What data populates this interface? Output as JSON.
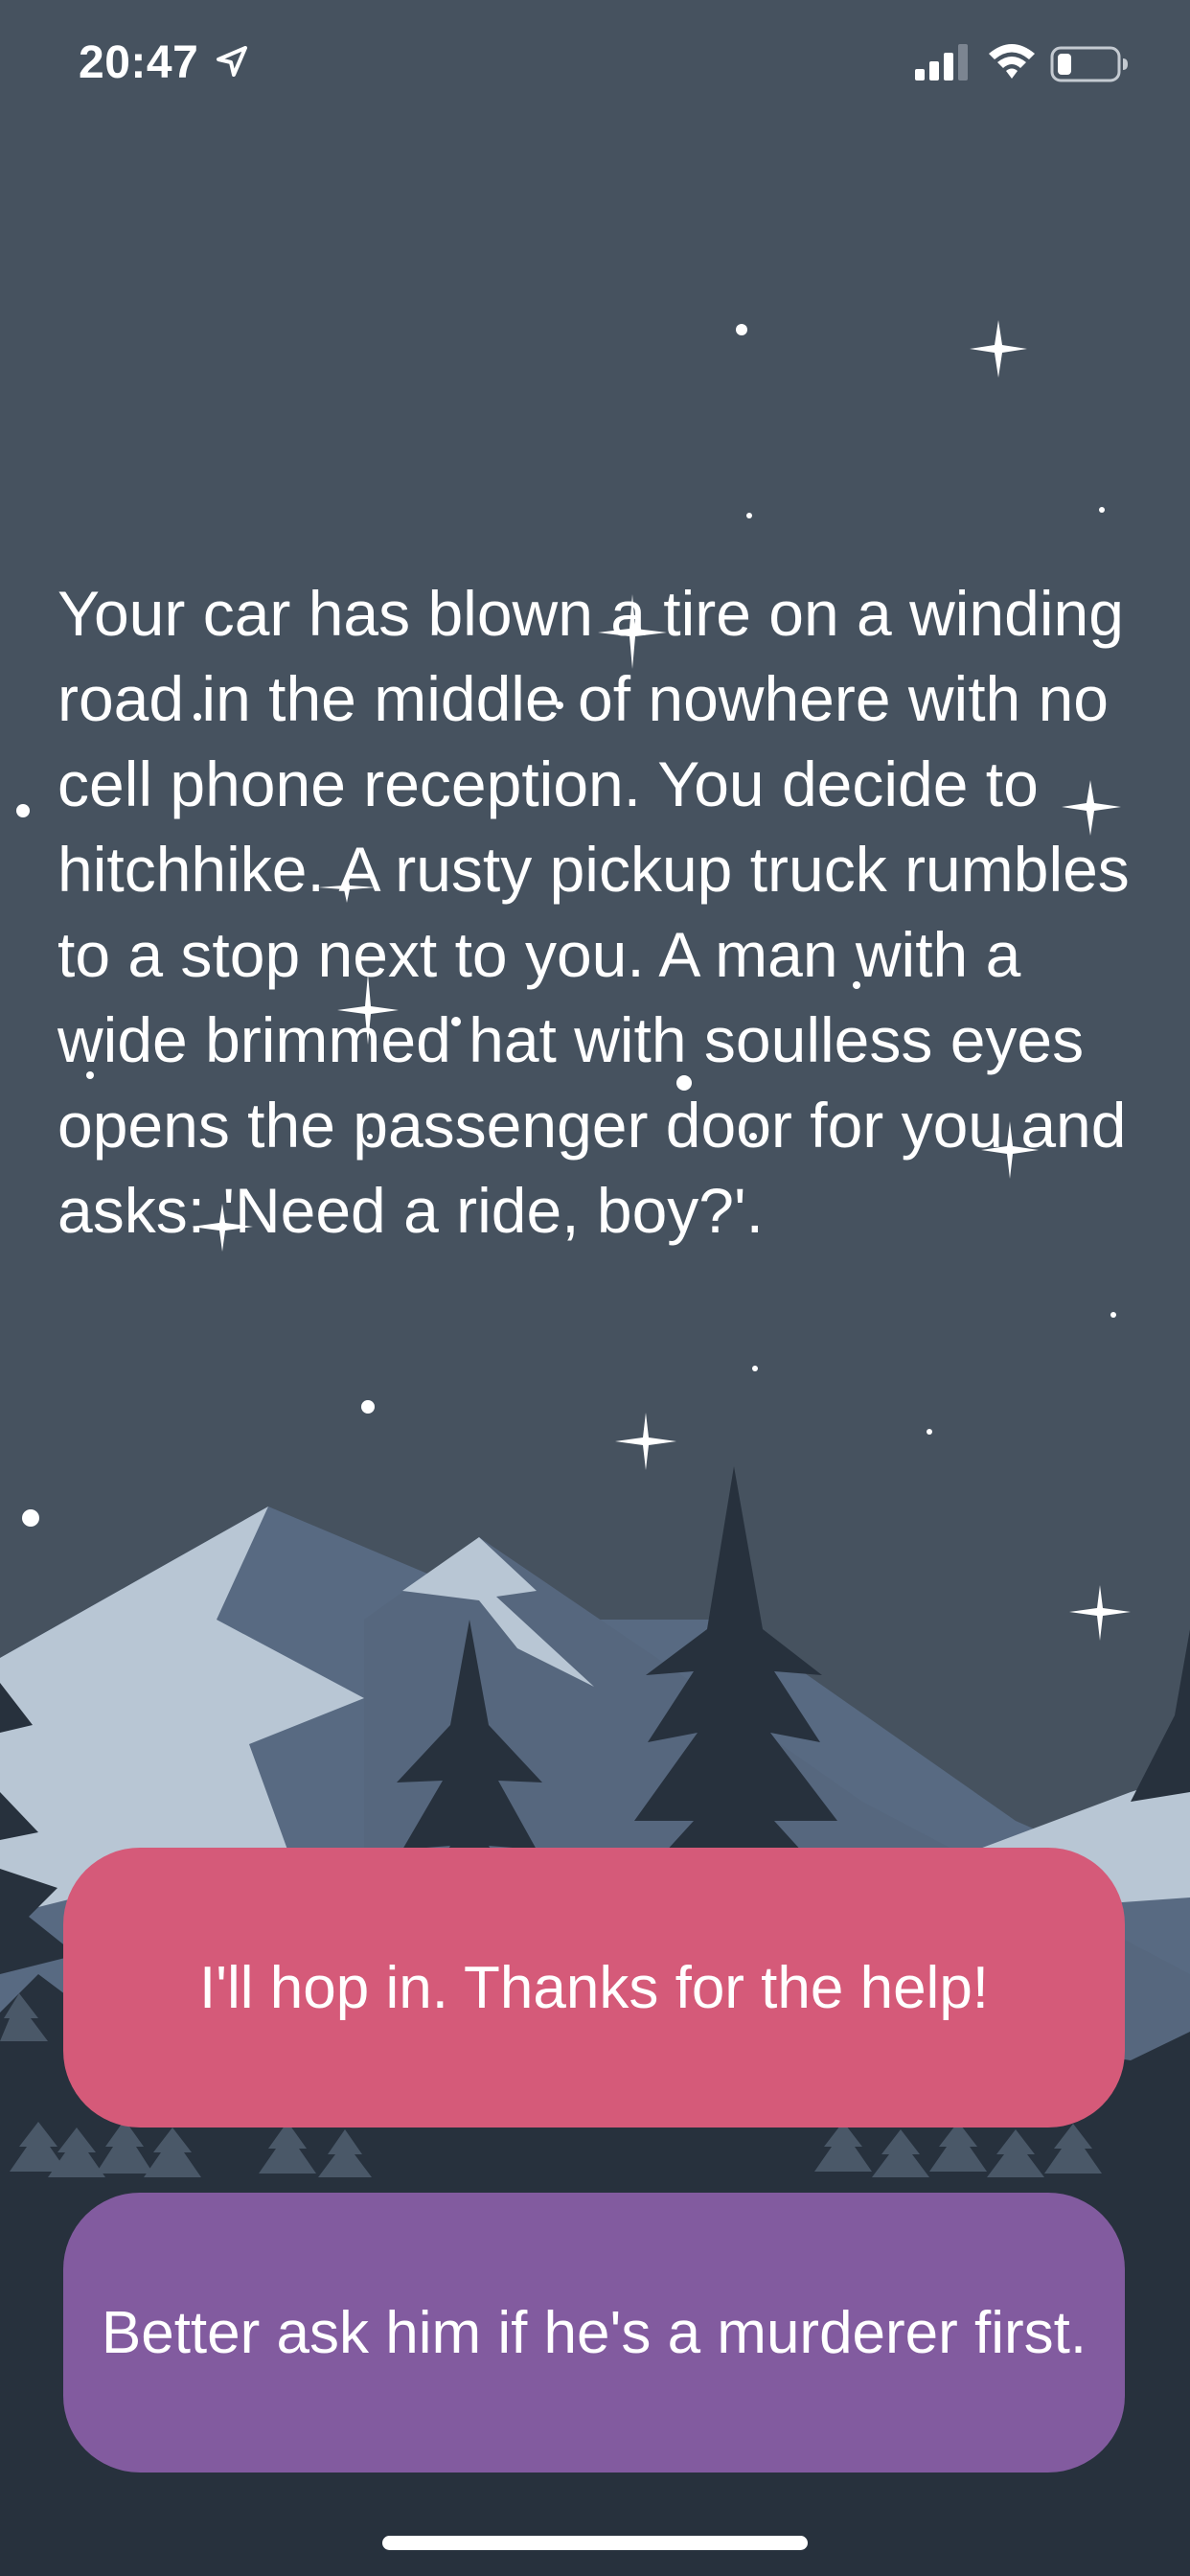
{
  "status_bar": {
    "time": "20:47",
    "icons": [
      "location-arrow-icon",
      "cellular-signal-icon",
      "wifi-icon",
      "battery-icon"
    ]
  },
  "story": {
    "text": "Your car has blown a tire on a winding road in the middle of nowhere with no cell phone reception. You decide to hitchhike. A rusty pickup truck rumbles to a stop next to you. A man with a wide brimmed hat with soulless eyes opens the passenger door for you and asks: 'Need a ride, boy?'."
  },
  "choices": [
    {
      "label": "I'll hop in. Thanks for the help!",
      "color": "#d55a79"
    },
    {
      "label": "Better ask him if he's a murderer first.",
      "color": "#825b9f"
    }
  ],
  "theme": {
    "sky": "#46525f",
    "mountain_dark": "#586a82",
    "snow": "#b8c6d4",
    "trees": "#27313d"
  }
}
